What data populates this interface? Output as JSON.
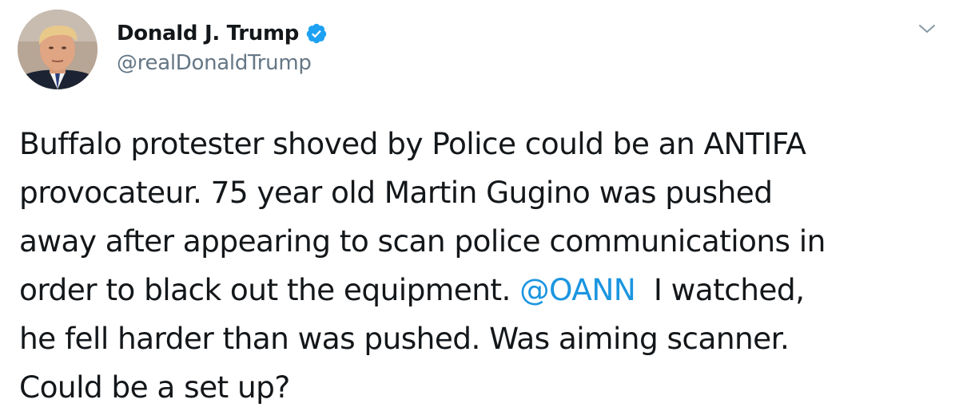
{
  "tweet": {
    "author": {
      "display_name": "Donald J. Trump",
      "handle": "@realDonaldTrump",
      "verified": true
    },
    "text_lines": {
      "line1": "Buffalo protester shoved by Police could be an ANTIFA",
      "line2": "provocateur. 75 year old Martin Gugino was pushed",
      "line3": "away after appearing to scan police communications in",
      "line4_before": "order to black out the equipment. ",
      "line4_mention": "@OANN",
      "line4_after": "  I watched,",
      "line5": "he fell harder than was pushed. Was aiming scanner.",
      "line6": "Could be a set up?"
    }
  },
  "icons": {
    "verified": "verified-badge-icon",
    "menu": "chevron-down-icon"
  },
  "colors": {
    "text": "#14171a",
    "secondary": "#657786",
    "link": "#1b95e0",
    "verified": "#1da1f2"
  }
}
